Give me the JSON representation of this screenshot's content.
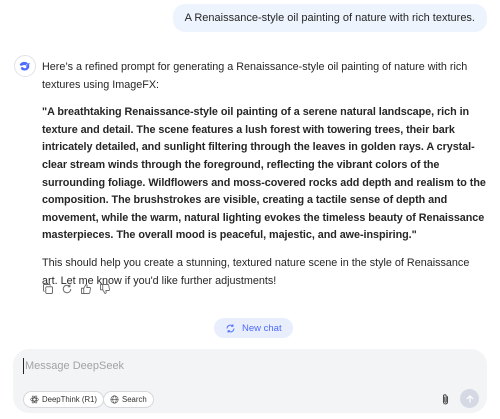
{
  "user_message": "A Renaissance-style oil painting of nature with rich textures.",
  "assistant": {
    "intro": "Here’s a refined prompt for generating a Renaissance-style oil painting of nature with rich textures using ImageFX:",
    "prompt_quote": "\"A breathtaking Renaissance-style oil painting of a serene natural landscape, rich in texture and detail. The scene features a lush forest with towering trees, their bark intricately detailed, and sunlight filtering through the leaves in golden rays. A crystal-clear stream winds through the foreground, reflecting the vibrant colors of the surrounding foliage. Wildflowers and moss-covered rocks add depth and realism to the composition. The brushstrokes are visible, creating a tactile sense of depth and movement, while the warm, natural lighting evokes the timeless beauty of Renaissance masterpieces. The overall mood is peaceful, majestic, and awe-inspiring.\"",
    "outro": "This should help you create a stunning, textured nature scene in the style of Renaissance art. Let me know if you'd like further adjustments!"
  },
  "actions": {
    "icons": [
      "copy-icon",
      "regenerate-icon",
      "thumbs-up-icon",
      "thumbs-down-icon"
    ]
  },
  "new_chat_label": "New chat",
  "composer": {
    "placeholder": "Message DeepSeek",
    "value": "",
    "deepthink_label": "DeepThink (R1)",
    "search_label": "Search"
  },
  "colors": {
    "accent": "#4d6bfe",
    "user_bubble_bg": "#eef4fd",
    "composer_bg": "#f3f4f6",
    "send_disabled": "#d4d9e4"
  }
}
